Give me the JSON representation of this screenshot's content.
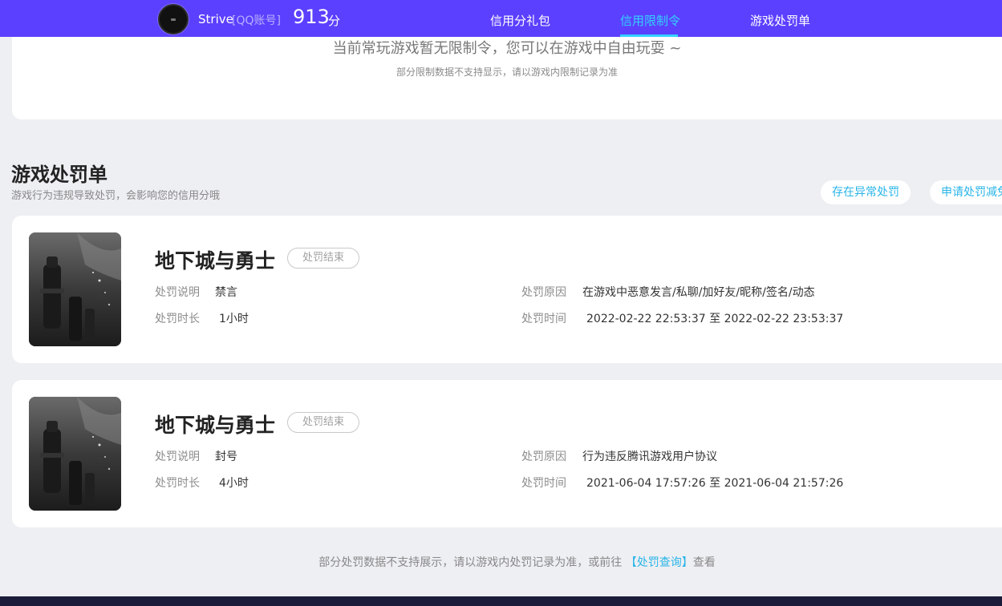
{
  "header": {
    "username": "Strive",
    "account_type": "[QQ账号]",
    "score": "913",
    "score_unit": "分",
    "nav": [
      "信用分礼包",
      "信用限制令",
      "游戏处罚单"
    ],
    "active_nav": "信用限制令",
    "accent_color": "#33d2ff",
    "bar_color": "#5b40ff"
  },
  "restriction": {
    "message": "当前常玩游戏暂无限制令，您可以在游戏中自由玩耍 ~",
    "note": "部分限制数据不支持显示，请以游戏内限制记录为准"
  },
  "penalty_section": {
    "title": "游戏处罚单",
    "subtitle": "游戏行为违规导致处罚，会影响您的信用分哦",
    "btn_report": "存在异常处罚",
    "btn_appeal": "申请处罚减免",
    "cards": [
      {
        "game": "地下城与勇士",
        "status": "处罚结束",
        "desc_label": "处罚说明",
        "desc": "禁言",
        "duration_label": "处罚时长",
        "duration": "1小时",
        "reason_label": "处罚原因",
        "reason": "在游戏中恶意发言/私聊/加好友/昵称/签名/动态",
        "time_label": "处罚时间",
        "time": "2022-02-22 22:53:37 至 2022-02-22 23:53:37"
      },
      {
        "game": "地下城与勇士",
        "status": "处罚结束",
        "desc_label": "处罚说明",
        "desc": "封号",
        "duration_label": "处罚时长",
        "duration": "4小时",
        "reason_label": "处罚原因",
        "reason": "行为违反腾讯游戏用户协议",
        "time_label": "处罚时间",
        "time": "2021-06-04 17:57:26 至 2021-06-04 21:57:26"
      }
    ]
  },
  "footer": {
    "prefix": "部分处罚数据不支持展示，请以游戏内处罚记录为准，或前往",
    "link": "【处罚查询】",
    "suffix": "查看"
  }
}
